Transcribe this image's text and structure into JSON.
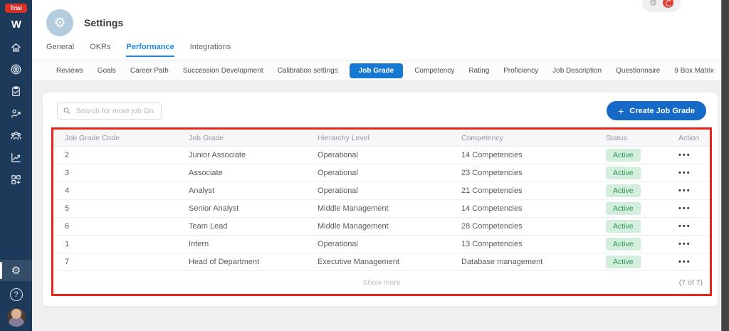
{
  "sidebar": {
    "trial_badge": "Trial",
    "logo": "W",
    "nav_icons": [
      "home-icon",
      "target-icon",
      "tasks-icon",
      "career-growth-icon",
      "team-icon",
      "analytics-icon",
      "apps-plus-icon"
    ],
    "bottom_icons": [
      "settings-gear-icon",
      "help-icon",
      "user-avatar"
    ],
    "settings_glyph": "⚙",
    "help_glyph": "?"
  },
  "header": {
    "title": "Settings",
    "page_icon": "gear-icon",
    "page_icon_glyph": "⚙",
    "tabs": [
      {
        "label": "General",
        "active": false
      },
      {
        "label": "OKRs",
        "active": false
      },
      {
        "label": "Performance",
        "active": true
      },
      {
        "label": "Integrations",
        "active": false
      }
    ],
    "quick_actions": {
      "gear_glyph": "⚙",
      "notification_badge_color": "#e03c31"
    }
  },
  "subtabs": [
    {
      "label": "Reviews",
      "active": false
    },
    {
      "label": "Goals",
      "active": false
    },
    {
      "label": "Career Path",
      "active": false
    },
    {
      "label": "Succession Development",
      "active": false
    },
    {
      "label": "Calibration settings",
      "active": false
    },
    {
      "label": "Job Grade",
      "active": true
    },
    {
      "label": "Competency",
      "active": false
    },
    {
      "label": "Rating",
      "active": false
    },
    {
      "label": "Proficiency",
      "active": false
    },
    {
      "label": "Job Description",
      "active": false
    },
    {
      "label": "Questionnaire",
      "active": false
    },
    {
      "label": "9 Box Matrix",
      "active": false
    }
  ],
  "toolbar": {
    "search_placeholder": "Search for more job Grades",
    "create_button_label": "Create Job Grade",
    "plus_glyph": "+"
  },
  "table": {
    "columns": [
      "Job Grade Code",
      "Job Grade",
      "Hierarchy Level",
      "Competency",
      "Status",
      "Action"
    ],
    "rows": [
      {
        "code": "2",
        "grade": "Junior Associate",
        "level": "Operational",
        "competency": "14 Competencies",
        "status": "Active"
      },
      {
        "code": "3",
        "grade": "Associate",
        "level": "Operational",
        "competency": "23 Competencies",
        "status": "Active"
      },
      {
        "code": "4",
        "grade": "Analyst",
        "level": "Operational",
        "competency": "21 Competencies",
        "status": "Active"
      },
      {
        "code": "5",
        "grade": "Senior Analyst",
        "level": "Middle Management",
        "competency": "14 Competencies",
        "status": "Active"
      },
      {
        "code": "6",
        "grade": "Team Lead",
        "level": "Middle Management",
        "competency": "28 Competencies",
        "status": "Active"
      },
      {
        "code": "1",
        "grade": "Intern",
        "level": "Operational",
        "competency": "13 Competencies",
        "status": "Active"
      },
      {
        "code": "7",
        "grade": "Head of Department",
        "level": "Executive Management",
        "competency": "Database management",
        "status": "Active"
      }
    ],
    "action_menu_glyph": "•••",
    "footer": {
      "show_more": "Show more",
      "count": "(7 of 7)"
    }
  },
  "colors": {
    "sidebar_bg": "#1e3a5a",
    "accent_blue": "#1a86e8",
    "subtab_blue": "#1778d2",
    "button_blue": "#1569c7",
    "annotation_red": "#e8251b",
    "badge_green_bg": "#d3eedd",
    "badge_green_text": "#27984d",
    "trial_red": "#d93025"
  }
}
